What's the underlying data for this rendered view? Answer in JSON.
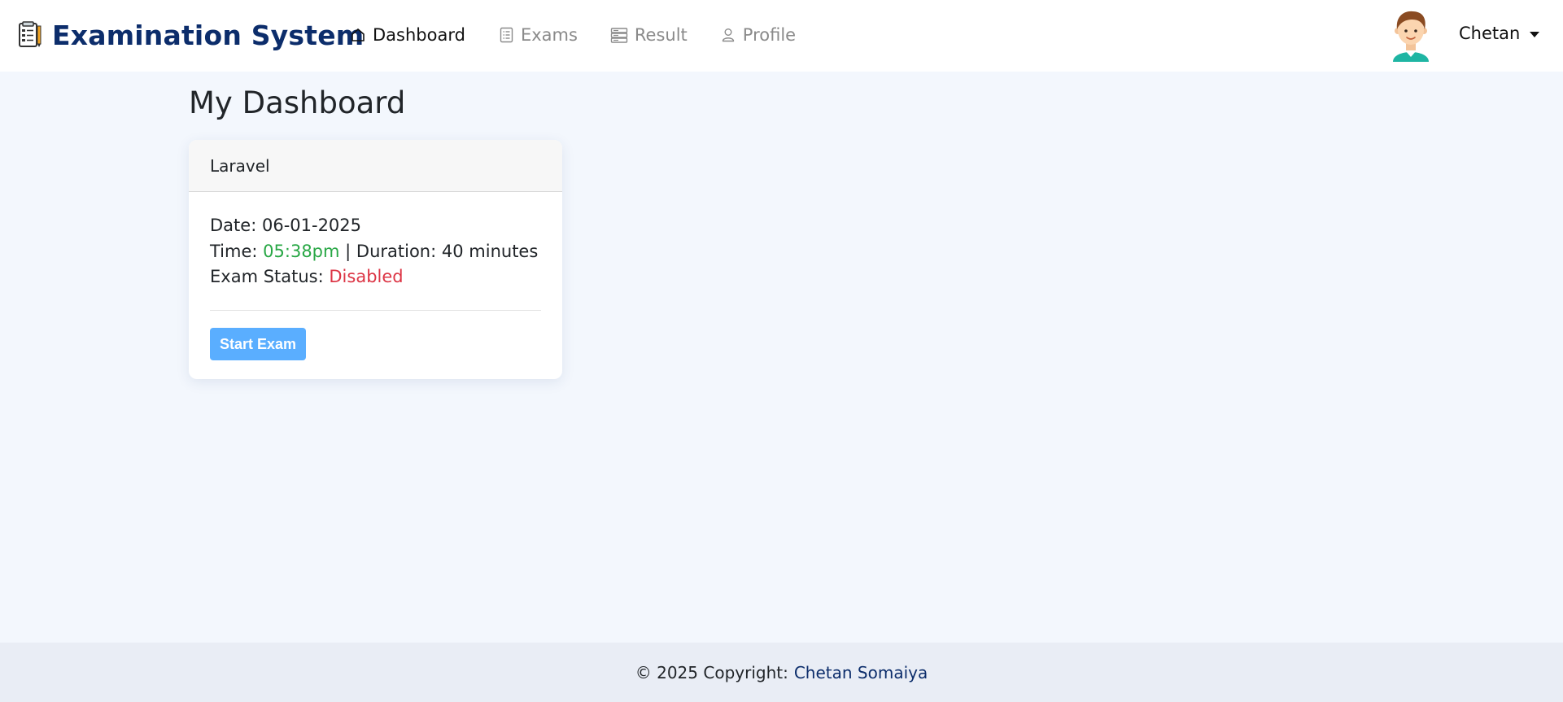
{
  "navbar": {
    "brand_title": "Examination System",
    "brand_icon": "exam-sheet-icon",
    "links": [
      {
        "label": "Dashboard",
        "icon": "home-icon",
        "active": true
      },
      {
        "label": "Exams",
        "icon": "list-icon",
        "active": false
      },
      {
        "label": "Result",
        "icon": "server-icon",
        "active": false
      },
      {
        "label": "Profile",
        "icon": "person-icon",
        "active": false
      }
    ],
    "user": {
      "name": "Chetan",
      "avatar": "avatar-boy"
    }
  },
  "main": {
    "title": "My Dashboard",
    "exam_card": {
      "name": "Laravel",
      "date_label": "Date:",
      "date": "06-01-2025",
      "time_label": "Time:",
      "time": "05:38pm",
      "duration_sep": "| Duration:",
      "duration": "40 minutes",
      "status_label": "Exam Status:",
      "status": "Disabled",
      "start_button": "Start Exam"
    }
  },
  "footer": {
    "copyright": "© 2025 Copyright:",
    "author": "Chetan Somaiya"
  },
  "colors": {
    "brand": "#0c2d6b",
    "time": "#28a745",
    "status": "#dc3545",
    "button": "#5aaeff",
    "background": "#f3f7fd"
  }
}
